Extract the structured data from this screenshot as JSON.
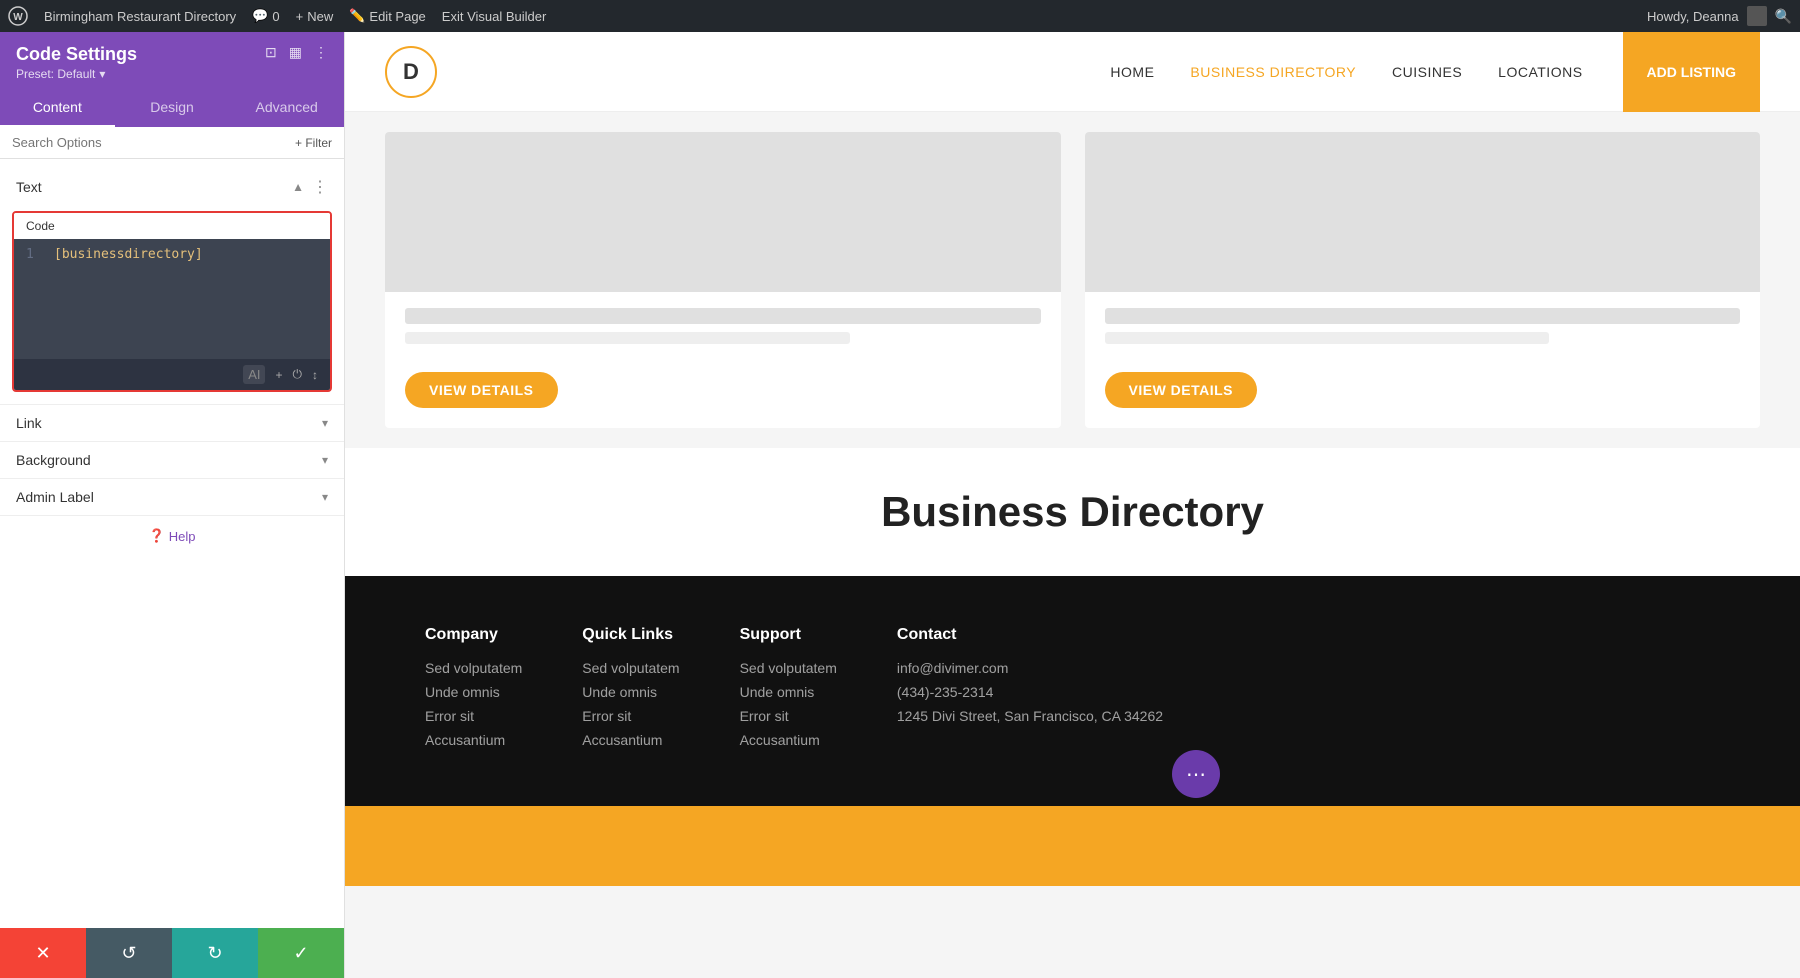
{
  "adminBar": {
    "siteName": "Birmingham Restaurant Directory",
    "commentCount": "0",
    "newLabel": "New",
    "editPage": "Edit Page",
    "exitBuilder": "Exit Visual Builder",
    "howdy": "Howdy, Deanna"
  },
  "sidebar": {
    "title": "Code Settings",
    "preset": "Preset: Default",
    "tabs": [
      {
        "label": "Content",
        "active": true
      },
      {
        "label": "Design",
        "active": false
      },
      {
        "label": "Advanced",
        "active": false
      }
    ],
    "searchPlaceholder": "Search Options",
    "filterLabel": "+ Filter",
    "sections": {
      "text": {
        "title": "Text",
        "expanded": true,
        "codeLabel": "Code",
        "codeLine": "[businessdirectory]",
        "lineNumber": "1"
      },
      "link": {
        "title": "Link",
        "expanded": false
      },
      "background": {
        "title": "Background",
        "expanded": false
      },
      "adminLabel": {
        "title": "Admin Label",
        "expanded": false
      }
    },
    "helpLabel": "Help",
    "bottomBar": {
      "cancelTitle": "✕",
      "undoTitle": "↺",
      "redoTitle": "↻",
      "saveTitle": "✓"
    }
  },
  "siteHeader": {
    "logoLetter": "D",
    "nav": [
      {
        "label": "HOME",
        "active": false
      },
      {
        "label": "BUSINESS DIRECTORY",
        "active": true
      },
      {
        "label": "CUISINES",
        "active": false
      },
      {
        "label": "LOCATIONS",
        "active": false
      }
    ],
    "addListingBtn": "ADD LISTING"
  },
  "mainContent": {
    "viewDetailsBtn": "VIEW DETAILS",
    "directoryTitle": "Business Directory"
  },
  "footer": {
    "columns": [
      {
        "title": "Company",
        "links": [
          "Sed volputatem",
          "Unde omnis",
          "Error sit",
          "Accusantium"
        ]
      },
      {
        "title": "Quick Links",
        "links": [
          "Sed volputatem",
          "Unde omnis",
          "Error sit",
          "Accusantium"
        ]
      },
      {
        "title": "Support",
        "links": [
          "Sed volputatem",
          "Unde omnis",
          "Error sit",
          "Accusantium"
        ]
      },
      {
        "title": "Contact",
        "links": [
          "info@divimer.com",
          "(434)-235-2314",
          "1245 Divi Street, San Francisco, CA 34262"
        ]
      }
    ]
  },
  "colors": {
    "purple": "#7e4bb8",
    "orange": "#f5a623",
    "red": "#e53935",
    "green": "#4caf50",
    "teal": "#26a69a",
    "slate": "#455a64"
  }
}
